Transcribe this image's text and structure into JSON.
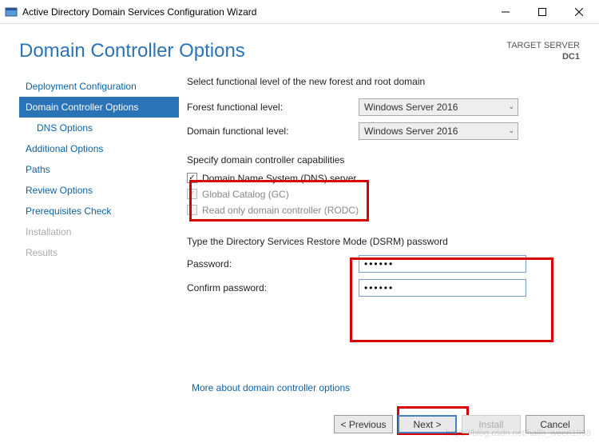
{
  "titlebar": {
    "title": "Active Directory Domain Services Configuration Wizard"
  },
  "header": {
    "page_title": "Domain Controller Options",
    "target_label": "TARGET SERVER",
    "target_value": "DC1"
  },
  "sidebar": {
    "items": [
      {
        "label": "Deployment Configuration"
      },
      {
        "label": "Domain Controller Options"
      },
      {
        "label": "DNS Options"
      },
      {
        "label": "Additional Options"
      },
      {
        "label": "Paths"
      },
      {
        "label": "Review Options"
      },
      {
        "label": "Prerequisites Check"
      },
      {
        "label": "Installation"
      },
      {
        "label": "Results"
      }
    ]
  },
  "content": {
    "functional_intro": "Select functional level of the new forest and root domain",
    "forest_label": "Forest functional level:",
    "forest_value": "Windows Server 2016",
    "domain_label": "Domain functional level:",
    "domain_value": "Windows Server 2016",
    "capabilities_label": "Specify domain controller capabilities",
    "dns_check": "Domain Name System (DNS) server",
    "gc_check": "Global Catalog (GC)",
    "rodc_check": "Read only domain controller (RODC)",
    "dsrm_intro": "Type the Directory Services Restore Mode (DSRM) password",
    "password_label": "Password:",
    "password_value": "••••••",
    "confirm_label": "Confirm password:",
    "confirm_value": "••••••",
    "more_link": "More about domain controller options"
  },
  "footer": {
    "previous": "< Previous",
    "next": "Next >",
    "install": "Install",
    "cancel": "Cancel"
  },
  "watermark": "https://blog.csdn.net/hallo_ween1998"
}
